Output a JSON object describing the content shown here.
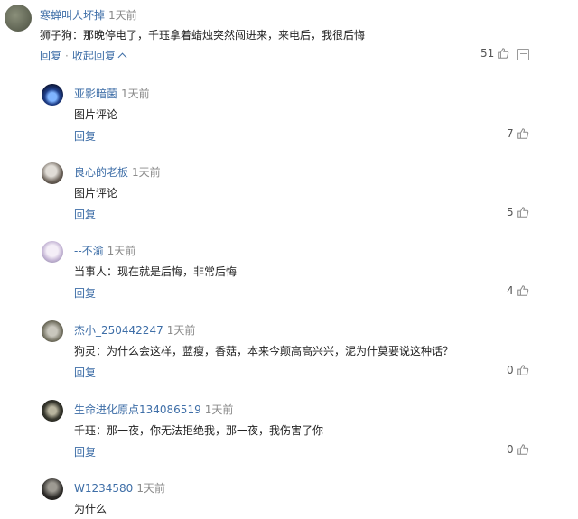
{
  "top_comment": {
    "username": "寒蝉叫人坏掉",
    "time": "1天前",
    "content": "狮子狗：那晚停电了，千珏拿着蜡烛突然闯进来，来电后，我很后悔",
    "reply_label": "回复",
    "collapse_label": "收起回复",
    "likes": "51"
  },
  "replies": [
    {
      "username": "亚影暗菌",
      "time": "1天前",
      "content": "图片评论",
      "reply_label": "回复",
      "likes": "7"
    },
    {
      "username": "良心的老板",
      "time": "1天前",
      "content": "图片评论",
      "reply_label": "回复",
      "likes": "5"
    },
    {
      "username": "--不渝",
      "time": "1天前",
      "content": "当事人：现在就是后悔，非常后悔",
      "reply_label": "回复",
      "likes": "4"
    },
    {
      "username": "杰小_250442247",
      "time": "1天前",
      "content": "狗灵：为什么会这样，蓝瘦，香菇，本来今颠高高兴兴，泥为什莫要说这种话？",
      "reply_label": "回复",
      "likes": "0"
    },
    {
      "username": "生命进化原点134086519",
      "time": "1天前",
      "content": "千珏：那一夜，你无法拒绝我，那一夜，我伤害了你",
      "reply_label": "回复",
      "likes": "0"
    },
    {
      "username": "W1234580",
      "time": "1天前",
      "content": "为什么"
    }
  ],
  "colors": {
    "link": "#3e6ea7",
    "text": "#222222",
    "meta": "#8a8a8a"
  },
  "icons": {
    "like": "thumbs-up-icon",
    "report": "report-icon",
    "collapse": "chevron-up-icon"
  }
}
